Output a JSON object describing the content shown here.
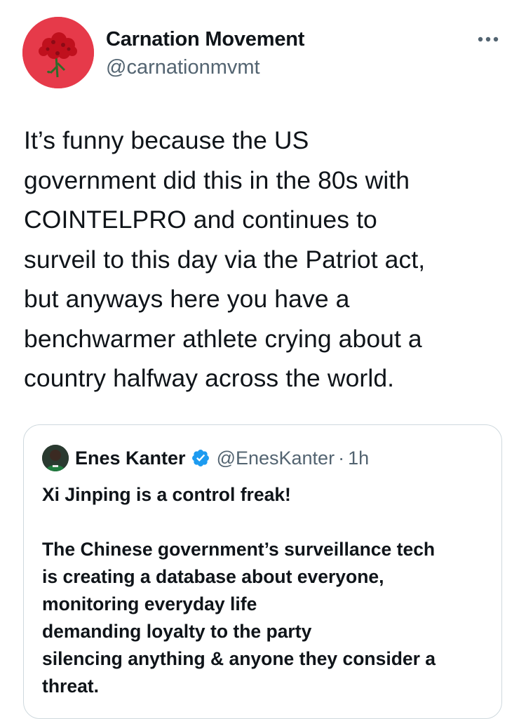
{
  "tweet": {
    "author_name": "Carnation Movement",
    "author_handle": "@carnationmvmt",
    "avatar_icon": "red-carnation-icon",
    "more_icon": "more-options-icon",
    "text": "It’s funny because the US\ngovernment did this in the 80s with\nCOINTELPRO and continues to\nsurveil to this day via the Patriot act,\nbut anyways here you have a\nbenchwarmer athlete crying about a\ncountry halfway across the world."
  },
  "quoted_tweet": {
    "author_name": "Enes Kanter",
    "verified_icon": "verified-badge-icon",
    "author_handle": "@EnesKanter",
    "separator": "·",
    "time": "1h",
    "text": "Xi Jinping is a control freak!\n\nThe Chinese government’s surveillance tech\nis creating a database about everyone,\nmonitoring everyday life\ndemanding loyalty to the party\nsilencing anything & anyone they consider a\nthreat."
  },
  "colors": {
    "text": "#0f1419",
    "secondary_text": "#536471",
    "border": "#cfd9de",
    "verified_blue": "#1d9bf0",
    "avatar_red": "#e63a4a"
  }
}
